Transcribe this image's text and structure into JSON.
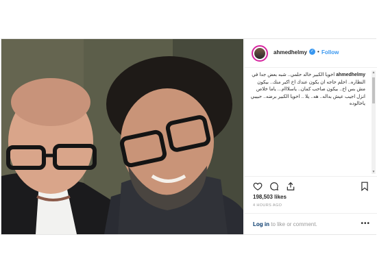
{
  "post": {
    "username": "ahmedhelmy",
    "follow_label": "Follow",
    "separator": "•",
    "caption_user": "ahmedhelmy",
    "caption_text": "اخويا الكبير خالد حلمي.. شبه بعض جدا في النظاره.. احلم حاجه ان يكون عندك اخ اكبر منك.. بيكون مش بس اخ.. بيكون صاحب كمان.. ياسلااام... ياما خلاص انزل اجيب عيش بداله.. هه.. يلا .. اخويا الكبير برضه.. حبيبي ياخالوده",
    "likes": "198,503 likes",
    "timestamp": "4 HOURS AGO",
    "login_link": "Log in",
    "login_rest": " to like or comment.",
    "more": "•••"
  },
  "icons": {
    "verified": "verified-badge-icon",
    "like": "heart-icon",
    "comment": "comment-icon",
    "share": "share-icon",
    "save": "bookmark-icon"
  },
  "colors": {
    "accent": "#3897f0",
    "ring": "#d6249f",
    "muted": "#999999"
  }
}
